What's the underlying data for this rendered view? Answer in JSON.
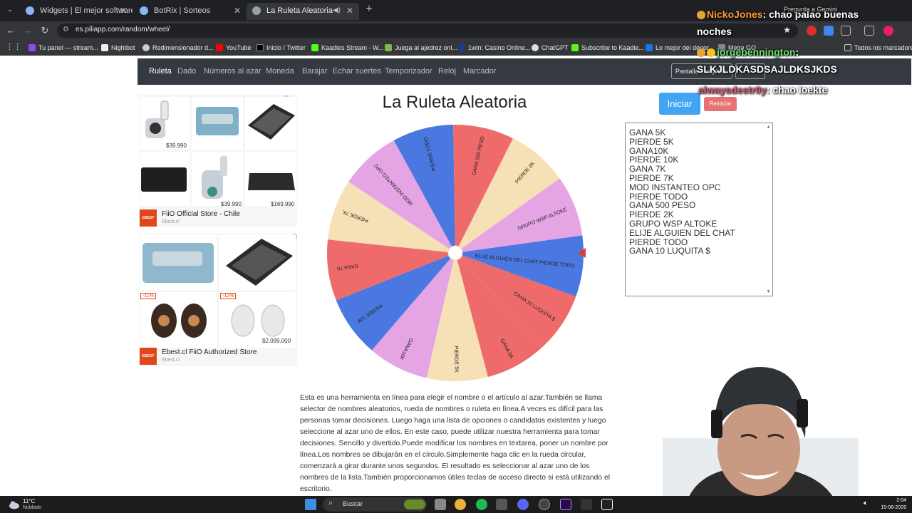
{
  "browser": {
    "tabs": [
      {
        "title": "Widgets | El mejor software pa",
        "active": false
      },
      {
        "title": "BotRix | Sorteos",
        "active": false
      },
      {
        "title": "La Ruleta Aleatoria",
        "active": true
      }
    ],
    "url": "es.piliapp.com/random/wheel/",
    "gemini_hint": "Pregunta a Gemini",
    "bookmarks": [
      "Tu panel — stream...",
      "Nightbot",
      "Redimensionador d...",
      "YouTube",
      "Inicio / Twitter",
      "Kaadies Stream - W...",
      "Juega al ajedrez onl...",
      "1win: Casino Online...",
      "ChatGPT",
      "Subscribe to Kaadie...",
      "Lo mejor del depor...",
      "Mega GO"
    ],
    "all_bookmarks": "Todos los marcadores"
  },
  "site": {
    "nav": [
      "Ruleta",
      "Dado",
      "Números al azar",
      "Moneda",
      "Barajar",
      "Echar suertes",
      "Temporizador",
      "Reloj",
      "Marcador"
    ],
    "fullscreen_label": "Pantalla completa",
    "title": "La Ruleta Aleatoria",
    "start_button": "Iniciar",
    "reset_button": "Reiniciar",
    "options": [
      "GANA 5K",
      "PIERDE 5K",
      "GANA10K",
      "PIERDE 10K",
      "GANA 7K",
      "PIERDE 7K",
      "MOD INSTANTEO OPC",
      "PIERDE TODO",
      "GANA 500 PESO",
      "PIERDE 2K",
      "GRUPO WSP ALTOKE",
      "ELIJE ALGUIEN DEL CHAT PIERDE TODO",
      "GANA 10 LUQUITA $"
    ],
    "description": "Esta es una herramienta en línea para elegir el nombre o el artículo al azar.También se llama selector de nombres aleatorios, rueda de nombres o ruleta en línea.A veces es difícil para las personas tomar decisiones. Luego haga una lista de opciones o candidatos existentes y luego seleccione al azar uno de ellos. En este caso, puede utilizar nuestra herramienta para tomar decisiones. Sencillo y divertido.Puede modificar los nombres en textarea, poner un nombre por línea.Los nombres se dibujarán en el círculo.Simplemente haga clic en la rueda circular, comenzará a girar durante unos segundos. El resultado es seleccionar al azar uno de los nombres de la lista.También proporcionamos útiles teclas de acceso directo si está utilizando el escritorio."
  },
  "ads": {
    "block1": {
      "prices": [
        "$39.990",
        "$39.990",
        "$169.990"
      ],
      "store": "FiiO Official Store - Chile",
      "sub": "Ebest.cl",
      "logo": "EBEST"
    },
    "block2": {
      "discounts": [
        "-11%",
        "-12%"
      ],
      "prices": [
        "$2.099.000"
      ],
      "store": "Ebest.cl FiiO Authorized Store",
      "sub": "Ebest.cl",
      "logo": "EBEST"
    }
  },
  "wheel": {
    "segments": [
      {
        "label": "GANA 5K",
        "color": "#ef6b6b"
      },
      {
        "label": "PIERDE 5K",
        "color": "#f6e0b5"
      },
      {
        "label": "GANA10K",
        "color": "#e5a5e5"
      },
      {
        "label": "PIERDE 10K",
        "color": "#4a78e0"
      },
      {
        "label": "GANA 7K",
        "color": "#ef6b6b"
      },
      {
        "label": "PIERDE 7K",
        "color": "#f6e0b5"
      },
      {
        "label": "MOD INSTANTEO OPC",
        "color": "#e5a5e5"
      },
      {
        "label": "PIERDE TODO",
        "color": "#4a78e0"
      },
      {
        "label": "GANA 500 PESO",
        "color": "#ef6b6b"
      },
      {
        "label": "PIERDE 2K",
        "color": "#f6e0b5"
      },
      {
        "label": "GRUPO WSP ALTOKE",
        "color": "#e5a5e5"
      },
      {
        "label": "ELIJE ALGUIEN DEL CHAT PIERDE TODO",
        "color": "#4a78e0"
      },
      {
        "label": "GANA 10 LUQUITA $",
        "color": "#ef6b6b"
      }
    ],
    "pointer_color": "#e53935"
  },
  "stream_chat": [
    {
      "nick": "NickoJones",
      "message": ": chao palao buenas"
    },
    {
      "nick": "",
      "message": "noches"
    },
    {
      "nick": "jorgebennington",
      "message": ":"
    },
    {
      "nick": "",
      "message": "SLKJLDKASDSAJLDKSJKDS"
    },
    {
      "nick": "alwaysdestr0y",
      "message": ": chao loekte"
    }
  ],
  "taskbar": {
    "temperature": "11°C",
    "weather": "Nublado",
    "search_label": "Buscar",
    "time": "2:04",
    "date": "15-08-2026"
  }
}
